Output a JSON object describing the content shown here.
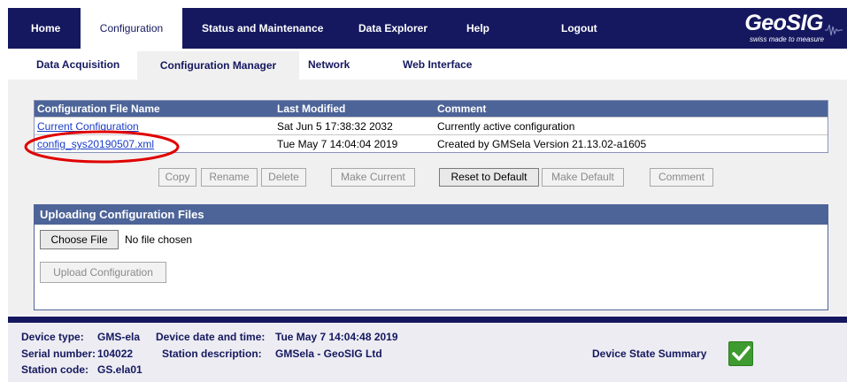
{
  "topnav": {
    "items": [
      "Home",
      "Configuration",
      "Status and Maintenance",
      "Data Explorer",
      "Help",
      "Logout"
    ],
    "active": "Configuration"
  },
  "logo": {
    "brand": "GeoSIG",
    "tagline": "swiss made to measure"
  },
  "subnav": {
    "items": [
      "Data Acquisition",
      "Configuration Manager",
      "Network",
      "Web Interface"
    ],
    "active": "Configuration Manager"
  },
  "files": {
    "headers": [
      "Configuration File Name",
      "Last Modified",
      "Comment"
    ],
    "rows": [
      {
        "name": "Current Configuration",
        "modified": "Sat Jun 5 17:38:32 2032",
        "comment": "Currently active configuration"
      },
      {
        "name": "config_sys20190507.xml",
        "modified": "Tue May 7 14:04:04 2019",
        "comment": "Created by GMSela Version 21.13.02-a1605"
      }
    ]
  },
  "actions": {
    "copy": "Copy",
    "rename": "Rename",
    "delete": "Delete",
    "make_current": "Make Current",
    "reset_default": "Reset to Default",
    "make_default": "Make Default",
    "comment": "Comment"
  },
  "upload": {
    "title": "Uploading Configuration Files",
    "choose": "Choose File",
    "no_file": "No file chosen",
    "upload_button": "Upload Configuration"
  },
  "footer": {
    "device_type_label": "Device type:",
    "device_type": "GMS-ela",
    "device_time_label": "Device date and time:",
    "device_time": "Tue May 7 14:04:48 2019",
    "serial_label": "Serial number:",
    "serial": "104022",
    "station_desc_label": "Station description:",
    "station_desc": "GMSela - GeoSIG Ltd",
    "station_code_label": "Station code:",
    "station_code": "GS.ela01",
    "state_summary": "Device State Summary"
  },
  "colors": {
    "nav": "#15185f",
    "header": "#4d6498",
    "ok": "#3e9b2f",
    "annotation": "#e00000"
  }
}
